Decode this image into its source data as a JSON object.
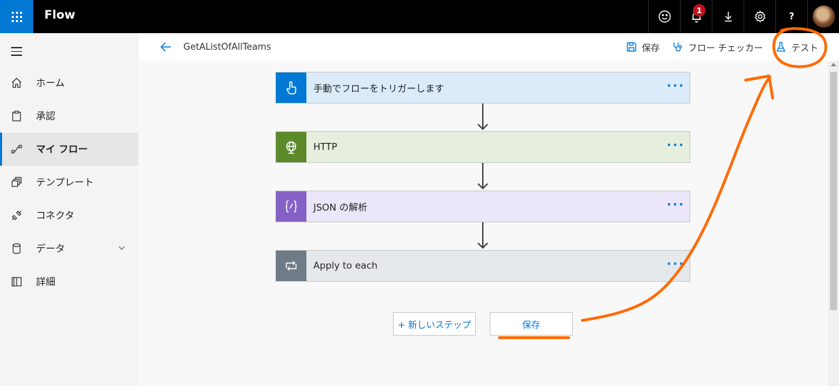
{
  "app": {
    "title": "Flow"
  },
  "topbar": {
    "notification_count": "1",
    "help_label": "?",
    "icons": [
      "smiley-icon",
      "bell-icon",
      "download-icon",
      "gear-icon",
      "help-icon"
    ]
  },
  "sidebar": {
    "items": [
      {
        "label": "ホーム",
        "icon": "home-icon"
      },
      {
        "label": "承認",
        "icon": "clipboard-icon"
      },
      {
        "label": "マイ フロー",
        "icon": "flow-icon",
        "active": true
      },
      {
        "label": "テンプレート",
        "icon": "template-icon"
      },
      {
        "label": "コネクタ",
        "icon": "connector-icon"
      },
      {
        "label": "データ",
        "icon": "database-icon",
        "expandable": true
      },
      {
        "label": "詳細",
        "icon": "book-icon"
      }
    ]
  },
  "commandbar": {
    "flow_name": "GetAListOfAllTeams",
    "save_label": "保存",
    "checker_label": "フロー チェッカー",
    "test_label": "テスト"
  },
  "steps": [
    {
      "title": "手動でフローをトリガーします",
      "color": "#0078d4",
      "bg": "#dcebfa",
      "icon": "touch-icon"
    },
    {
      "title": "HTTP",
      "color": "#5c8a2b",
      "bg": "#e6efdd",
      "icon": "globe-icon"
    },
    {
      "title": "JSON の解析",
      "color": "#8661c5",
      "bg": "#ece6fa",
      "icon": "braces-icon"
    },
    {
      "title": "Apply to each",
      "color": "#6f7b86",
      "bg": "#e6e9ec",
      "icon": "loop-icon"
    }
  ],
  "step_more_label": "···",
  "actions": {
    "new_step_label": "+ 新しいステップ",
    "save_label": "保存"
  },
  "colors": {
    "accent": "#0078d4",
    "annotation": "#ff6a00"
  }
}
